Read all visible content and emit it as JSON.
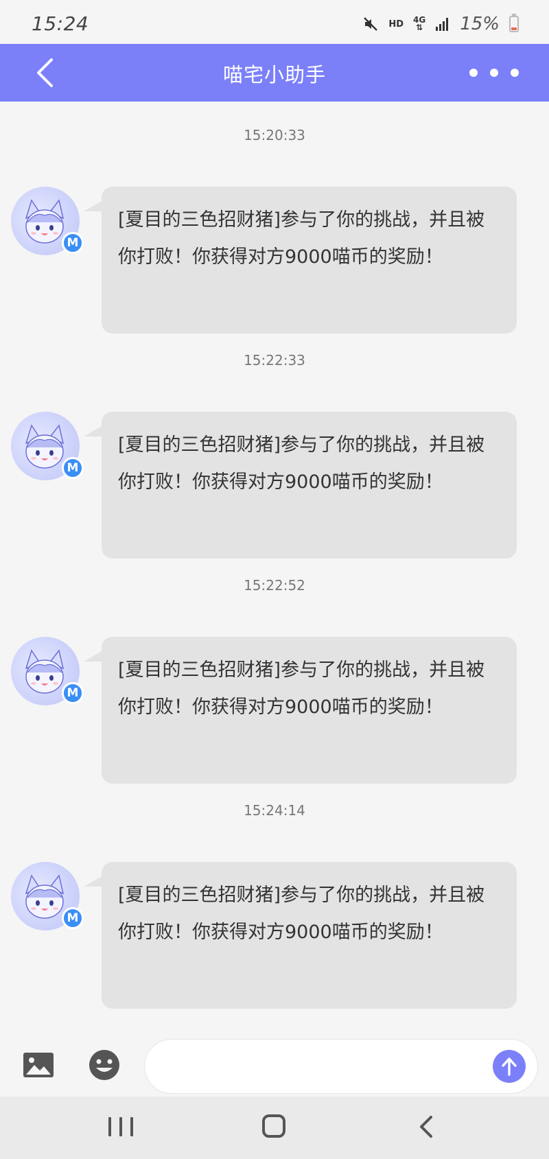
{
  "status_bar": {
    "time": "15:24",
    "hd_label": "HD",
    "network_label": "4G",
    "battery_percent": "15%",
    "battery_color": "#e46b5a"
  },
  "header": {
    "title": "喵宅小助手",
    "back_icon": "chevron-left-icon",
    "more_icon": "more-dots-icon",
    "background_color": "#7b80f9"
  },
  "messages": [
    {
      "timestamp": "15:20:33",
      "text": "[夏目的三色招财猪]参与了你的挑战，并且被你打败！你获得对方9000喵币的奖励！",
      "avatar_badge": "M"
    },
    {
      "timestamp": "15:22:33",
      "text": "[夏目的三色招财猪]参与了你的挑战，并且被你打败！你获得对方9000喵币的奖励！",
      "avatar_badge": "M"
    },
    {
      "timestamp": "15:22:52",
      "text": "[夏目的三色招财猪]参与了你的挑战，并且被你打败！你获得对方9000喵币的奖励！",
      "avatar_badge": "M"
    },
    {
      "timestamp": "15:24:14",
      "text": "[夏目的三色招财猪]参与了你的挑战，并且被你打败！你获得对方9000喵币的奖励！",
      "avatar_badge": "M"
    }
  ],
  "input_bar": {
    "value": "",
    "placeholder": "",
    "image_icon": "image-icon",
    "emoji_icon": "emoji-icon",
    "send_icon": "arrow-up-icon"
  },
  "nav_bar": {
    "recents_icon": "recents-icon",
    "home_icon": "home-icon",
    "back_icon": "back-icon"
  }
}
